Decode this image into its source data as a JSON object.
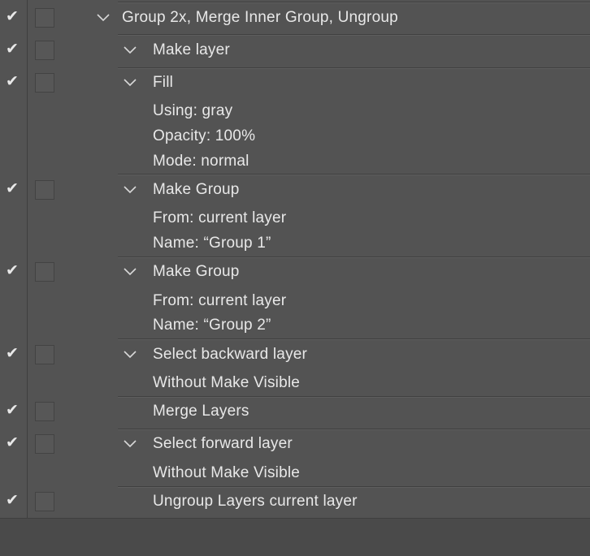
{
  "actions": {
    "group": {
      "title": "Group 2x, Merge Inner Group, Ungroup"
    },
    "steps": [
      {
        "title": "Make layer",
        "params": []
      },
      {
        "title": "Fill",
        "params": [
          "Using: gray",
          "Opacity: 100%",
          "Mode: normal"
        ]
      },
      {
        "title": "Make Group",
        "params": [
          "From: current layer",
          "Name:  “Group 1”"
        ]
      },
      {
        "title": "Make Group",
        "params": [
          "From: current layer",
          "Name:  “Group 2”"
        ]
      },
      {
        "title": "Select backward layer",
        "params": [
          "Without Make Visible"
        ]
      },
      {
        "title": "Merge Layers",
        "params": []
      },
      {
        "title": "Select forward layer",
        "params": [
          "Without Make Visible"
        ]
      },
      {
        "title": "Ungroup Layers current layer",
        "params": []
      }
    ]
  },
  "icons": {
    "check": "checkmark-icon",
    "chevron": "chevron-down-icon"
  },
  "colors": {
    "background": "#535353",
    "text": "#e6e6e6"
  }
}
